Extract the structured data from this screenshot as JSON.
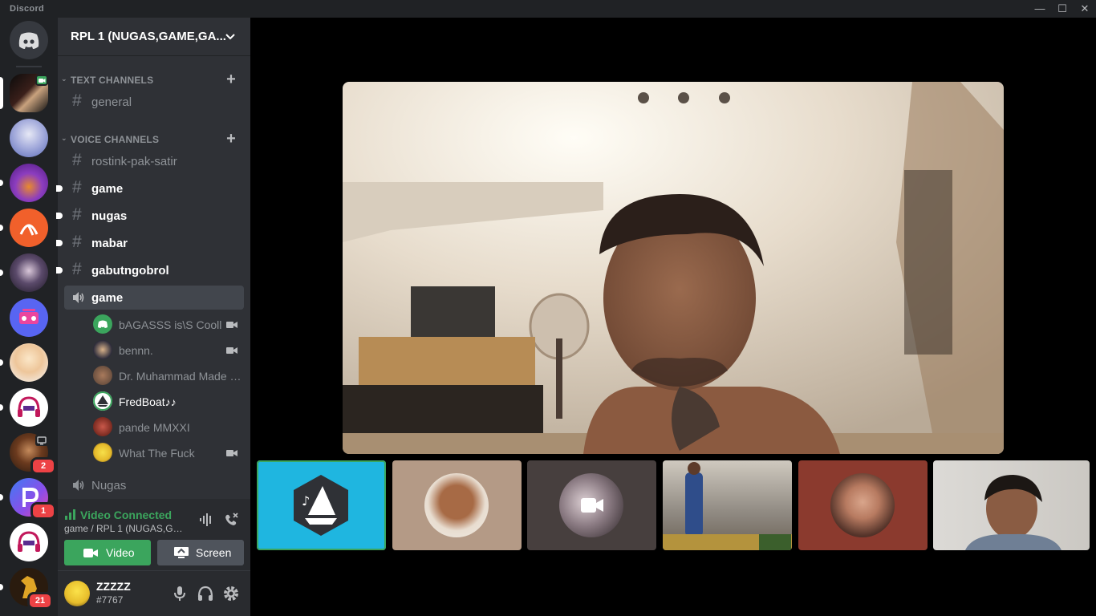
{
  "app": {
    "title": "Discord"
  },
  "window": {
    "minimize": "—",
    "maximize": "☐",
    "close": "✕"
  },
  "guilds": [
    {
      "name": "home",
      "badge": ""
    },
    {
      "name": "server-active",
      "badge": ""
    },
    {
      "name": "server-anime-girl",
      "badge": ""
    },
    {
      "name": "server-purple",
      "badge": ""
    },
    {
      "name": "server-orange-logo",
      "badge": ""
    },
    {
      "name": "server-dark-anime",
      "badge": ""
    },
    {
      "name": "server-boombox",
      "badge": ""
    },
    {
      "name": "server-blonde-anime",
      "badge": ""
    },
    {
      "name": "server-music-1",
      "badge": ""
    },
    {
      "name": "server-character",
      "badge": "2"
    },
    {
      "name": "server-p-logo",
      "badge": "1"
    },
    {
      "name": "server-music-2",
      "badge": ""
    },
    {
      "name": "server-horse",
      "badge": "21"
    }
  ],
  "server": {
    "name": "RPL 1 (NUGAS,GAME,GA..."
  },
  "text_category": {
    "label": "TEXT CHANNELS"
  },
  "voice_category": {
    "label": "VOICE CHANNELS"
  },
  "text_channels": [
    {
      "name": "general",
      "unread": false
    }
  ],
  "voice_text_channels": [
    {
      "name": "rostink-pak-satir",
      "unread": false
    },
    {
      "name": "game",
      "unread": true
    },
    {
      "name": "nugas",
      "unread": true
    },
    {
      "name": "mabar",
      "unread": true
    },
    {
      "name": "gabutngobrol",
      "unread": true
    }
  ],
  "active_voice": {
    "name": "game",
    "users": [
      {
        "name": "bAGASSS is\\S Cooll",
        "camera": true
      },
      {
        "name": "bennn.",
        "camera": true
      },
      {
        "name": "Dr. Muhammad Made m...",
        "camera": false
      },
      {
        "name": "FredBoat♪♪",
        "camera": false,
        "bot": true
      },
      {
        "name": "pande MMXXI",
        "camera": false
      },
      {
        "name": "What The Fuck",
        "camera": true
      }
    ]
  },
  "other_voice": {
    "name": "Nugas"
  },
  "rtc": {
    "status": "Video Connected",
    "channel": "game / RPL 1 (NUGAS,GAM...",
    "video_label": "Video",
    "screen_label": "Screen"
  },
  "user": {
    "name": "ZZZZZ",
    "tag": "#7767"
  },
  "colors": {
    "green": "#3ba55d",
    "blurple": "#5865f2",
    "red": "#ed4245",
    "fredboat_tile": "#1fb6e0"
  },
  "tiles": [
    {
      "name": "fredboat",
      "speaking": true
    },
    {
      "name": "user-2",
      "speaking": false
    },
    {
      "name": "user-3-camera-off",
      "speaking": false
    },
    {
      "name": "user-4",
      "speaking": false
    },
    {
      "name": "user-5",
      "speaking": false
    },
    {
      "name": "user-6",
      "speaking": false
    }
  ]
}
